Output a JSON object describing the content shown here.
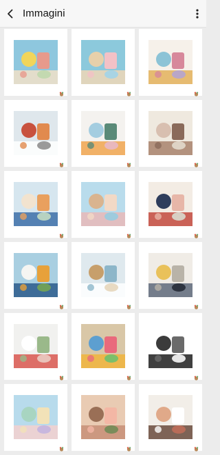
{
  "header": {
    "title": "Immagini"
  },
  "icons": {
    "back": "arrow-back-icon",
    "menu": "more-vertical-icon",
    "badge": "brand-logo-icon"
  },
  "images": [
    {
      "name": "montessori-toys-photo",
      "colors": [
        "#8ec7de",
        "#f2e0c8",
        "#f1d55a",
        "#e79a8c",
        "#c3d9b0"
      ]
    },
    {
      "name": "star-wall-decor-photo",
      "colors": [
        "#8cc9dc",
        "#efd7b6",
        "#e7d0aa",
        "#f3c1c6",
        "#a8d4e4"
      ]
    },
    {
      "name": "felt-bowls-photo",
      "colors": [
        "#f6f1ea",
        "#e3b25c",
        "#8cc3d6",
        "#d7889b",
        "#b9a6c7"
      ]
    },
    {
      "name": "baby-outfit-photo",
      "colors": [
        "#dfe7ec",
        "#ffffff",
        "#c8523e",
        "#e18a4e",
        "#9a9a9a"
      ]
    },
    {
      "name": "pacifier-clips-photo",
      "colors": [
        "#f4f2ef",
        "#f0a64f",
        "#a4cde0",
        "#5a8a78",
        "#e9b8bd"
      ]
    },
    {
      "name": "knit-cardigan-photo",
      "colors": [
        "#efe9df",
        "#a8826d",
        "#d8bfb0",
        "#8a6a5a",
        "#ded3c5"
      ]
    },
    {
      "name": "bottles-and-books-photo",
      "colors": [
        "#d6e6ef",
        "#3d6fa8",
        "#f2e3cf",
        "#e9a05e",
        "#b7d2c1"
      ]
    },
    {
      "name": "wooden-bus-toy-photo",
      "colors": [
        "#b9dcec",
        "#e8b8b8",
        "#d9b48f",
        "#f2d9c6",
        "#9ecbdd"
      ]
    },
    {
      "name": "hats-and-bonnets-photo",
      "colors": [
        "#f3ece4",
        "#c24a3e",
        "#2f3d5c",
        "#e7b6a8",
        "#d8cfc3"
      ]
    },
    {
      "name": "backpack-and-sheep-photo",
      "colors": [
        "#a9cfe1",
        "#2b5a8b",
        "#f5f5f2",
        "#e7a13a",
        "#6f9f5a"
      ]
    },
    {
      "name": "learning-tower-photo",
      "colors": [
        "#dfe9ee",
        "#ffffff",
        "#c79f6b",
        "#8db6c9",
        "#e8dac2"
      ]
    },
    {
      "name": "girls-dresses-photo",
      "colors": [
        "#f0ece6",
        "#5e6a7a",
        "#e9c15a",
        "#b9b3a8",
        "#2e3440"
      ]
    },
    {
      "name": "strawberry-sleepsack-photo",
      "colors": [
        "#f1f1ef",
        "#d9574f",
        "#ffffff",
        "#9ab98a",
        "#e9c2b9"
      ]
    },
    {
      "name": "crayon-sets-photo",
      "colors": [
        "#d9c7a7",
        "#f0b43c",
        "#5d9fd0",
        "#e96a7c",
        "#7cbf6a"
      ]
    },
    {
      "name": "black-outfit-photo",
      "colors": [
        "#ffffff",
        "#1e1e1e",
        "#3b3b3b",
        "#6a6a6a",
        "#e6e6e6"
      ]
    },
    {
      "name": "pastel-toys-photo",
      "colors": [
        "#b8dbec",
        "#f3d0cf",
        "#a8d5c1",
        "#f2e2b8",
        "#c8b7de"
      ]
    },
    {
      "name": "crochet-flower-photo",
      "colors": [
        "#e9cbb3",
        "#c78f77",
        "#9a6f56",
        "#f3b7a5",
        "#7a8c5a"
      ]
    },
    {
      "name": "patterned-fabrics-photo",
      "colors": [
        "#f2eee8",
        "#6a4a3c",
        "#e0a989",
        "#ffffff",
        "#b86c58"
      ]
    }
  ]
}
